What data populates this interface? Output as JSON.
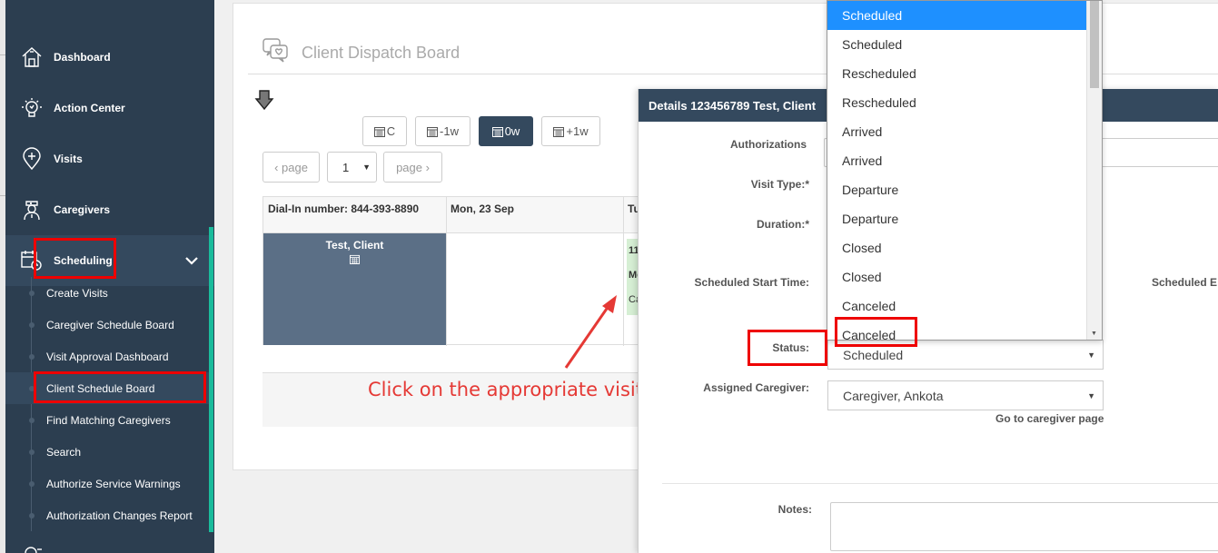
{
  "sidebar": {
    "items": [
      {
        "label": "Dashboard",
        "icon": "house-icon"
      },
      {
        "label": "Action Center",
        "icon": "lightbulb-icon"
      },
      {
        "label": "Visits",
        "icon": "map-pin-plus-icon"
      },
      {
        "label": "Caregivers",
        "icon": "nurse-icon"
      },
      {
        "label": "Scheduling",
        "icon": "calendar-clock-icon"
      }
    ],
    "sub_items": [
      "Create Visits",
      "Caregiver Schedule Board",
      "Visit Approval Dashboard",
      "Client Schedule Board",
      "Find Matching Caregivers",
      "Search",
      "Authorize Service Warnings",
      "Authorization Changes Report"
    ],
    "active_sub": "Client Schedule Board",
    "accent_color": "#1abc9c",
    "bg_color": "#2c3e50"
  },
  "page": {
    "title": "Client Dispatch Board",
    "title_icon": "chat-heart-icon"
  },
  "toolbar": {
    "btn_current": "C",
    "btn_prev_week": "-1w",
    "btn_this_week": "0w",
    "btn_next_week": "+1w",
    "prev_page": "‹ page",
    "page_value": "1",
    "next_page": "page ›"
  },
  "grid": {
    "dial_in": "Dial-In number: 844-393-8890",
    "col_mon": "Mon, 23 Sep",
    "col_tue": "Tu",
    "client_name": "Test, Client",
    "visit_chip_lines": [
      "11",
      "Mo",
      "Ca"
    ]
  },
  "annotation": {
    "text": "Click on the appropriate visit",
    "color": "#e53935"
  },
  "details": {
    "header": "Details 123456789 Test, Client",
    "labels": {
      "authorizations": "Authorizations",
      "visit_type": "Visit Type:*",
      "duration": "Duration:*",
      "scheduled_start": "Scheduled Start Time:",
      "scheduled_end": "Scheduled E",
      "status": "Status:",
      "assigned_caregiver": "Assigned Caregiver:",
      "notes": "Notes:"
    },
    "status_value": "Scheduled",
    "caregiver_value": "Caregiver, Ankota",
    "caregiver_link": "Go to caregiver page"
  },
  "status_dropdown": {
    "options": [
      "Scheduled",
      "Scheduled",
      "Rescheduled",
      "Rescheduled",
      "Arrived",
      "Arrived",
      "Departure",
      "Departure",
      "Closed",
      "Closed",
      "Canceled",
      "Canceled"
    ],
    "highlighted_index": 0,
    "highlight_color": "#1e90ff"
  },
  "annotation_color": "#ee0000"
}
